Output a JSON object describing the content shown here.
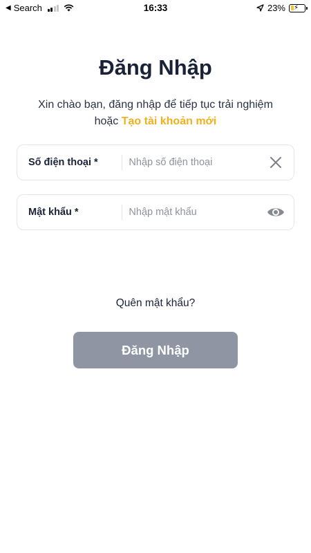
{
  "status_bar": {
    "back_label": "Search",
    "time": "16:33",
    "battery_percent": "23%",
    "battery_level": 0.23,
    "charging": true
  },
  "login": {
    "title": "Đăng Nhập",
    "subtitle_text": "Xin chào bạn, đăng nhập để tiếp tục trải nghiệm hoặc ",
    "create_account_link": "Tạo tài khoản mới",
    "phone": {
      "label": "Số điện thoại *",
      "placeholder": "Nhập số điện thoại",
      "value": "",
      "clear_icon": "close-icon"
    },
    "password": {
      "label": "Mật khẩu *",
      "placeholder": "Nhập mật khẩu",
      "value": "",
      "toggle_icon": "eye-icon"
    },
    "forgot_password": "Quên mật khẩu?",
    "submit_label": "Đăng Nhập"
  },
  "colors": {
    "accent": "#f2b01e",
    "button_disabled": "#8f95a3",
    "title": "#1a2238"
  }
}
